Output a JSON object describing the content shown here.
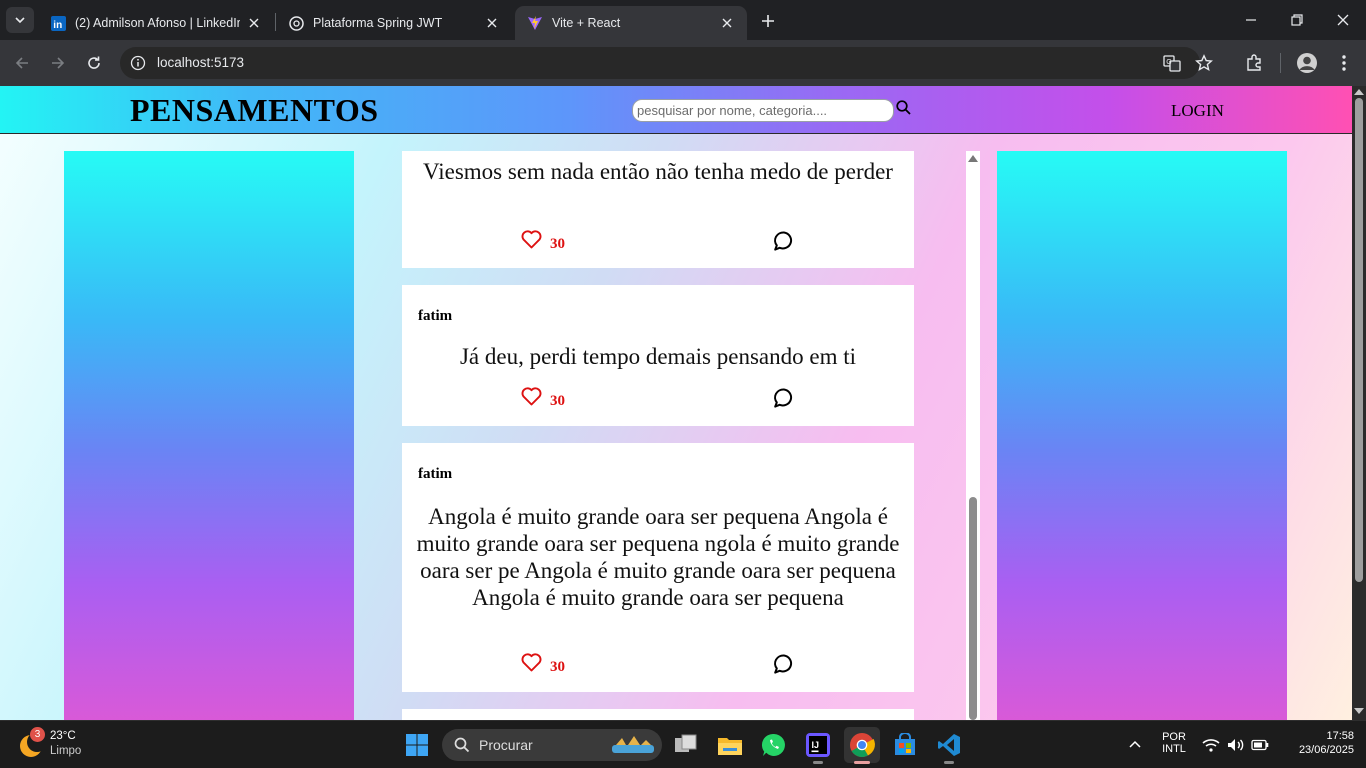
{
  "browser": {
    "tabs": [
      {
        "title": "(2) Admilson Afonso | LinkedIn",
        "icon": "linkedin-icon",
        "active": false
      },
      {
        "title": "Plataforma Spring JWT",
        "icon": "openai-icon",
        "active": false
      },
      {
        "title": "Vite + React",
        "icon": "vite-icon",
        "active": true
      }
    ],
    "url": "localhost:5173"
  },
  "app": {
    "brand": "PENSAMENTOS",
    "search_placeholder": "pesquisar por nome, categoria....",
    "login_label": "LOGIN",
    "posts": [
      {
        "author": "",
        "text": "Viesmos sem nada então não tenha medo de perder",
        "likes": "30"
      },
      {
        "author": "fatim",
        "text": "Já deu, perdi tempo demais pensando em ti",
        "likes": "30"
      },
      {
        "author": "fatim",
        "text": "Angola é muito grande oara ser pequena Angola é muito grande oara ser pequena ngola é muito grande oara ser pe Angola é muito grande oara ser pequena Angola é muito grande oara ser pequena",
        "likes": "30"
      }
    ],
    "colors": {
      "like": "#dd1111",
      "header_start": "#23f4f4",
      "header_end": "#ff50b3"
    }
  },
  "taskbar": {
    "weather": {
      "temp": "23°C",
      "condition": "Limpo",
      "badge": "3"
    },
    "search_label": "Procurar",
    "language": {
      "line1": "POR",
      "line2": "INTL"
    },
    "time": "17:58",
    "date": "23/06/2025"
  }
}
